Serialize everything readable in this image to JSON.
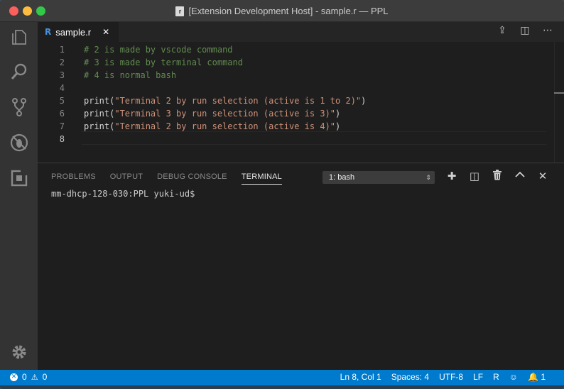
{
  "window": {
    "title": "[Extension Development Host] - sample.r — PPL",
    "title_icon": "r-file-icon"
  },
  "activity_bar": {
    "items": [
      {
        "name": "explorer-icon"
      },
      {
        "name": "search-icon"
      },
      {
        "name": "source-control-icon"
      },
      {
        "name": "debug-icon"
      },
      {
        "name": "extensions-icon"
      }
    ],
    "bottom": {
      "name": "settings-gear-icon"
    }
  },
  "tabs": [
    {
      "label": "sample.r",
      "icon": "R",
      "close": "✕"
    }
  ],
  "editor_actions": [
    "⇪",
    "◫",
    "⋯"
  ],
  "editor": {
    "lines": [
      {
        "num": "1",
        "parts": [
          {
            "t": "comment",
            "s": "# 2 is made by vscode command"
          }
        ]
      },
      {
        "num": "2",
        "parts": [
          {
            "t": "comment",
            "s": "# 3 is made by terminal command"
          }
        ]
      },
      {
        "num": "3",
        "parts": [
          {
            "t": "comment",
            "s": "# 4 is normal bash"
          }
        ]
      },
      {
        "num": "4",
        "parts": []
      },
      {
        "num": "5",
        "parts": [
          {
            "t": "func",
            "s": "print("
          },
          {
            "t": "str",
            "s": "\"Terminal 2 by run selection (active is 1 to 2)\""
          },
          {
            "t": "func",
            "s": ")"
          }
        ]
      },
      {
        "num": "6",
        "parts": [
          {
            "t": "func",
            "s": "print("
          },
          {
            "t": "str",
            "s": "\"Terminal 3 by run selection (active is 3)\""
          },
          {
            "t": "func",
            "s": ")"
          }
        ]
      },
      {
        "num": "7",
        "parts": [
          {
            "t": "func",
            "s": "print("
          },
          {
            "t": "str",
            "s": "\"Terminal 2 by run selection (active is 4)\""
          },
          {
            "t": "func",
            "s": ")"
          }
        ]
      },
      {
        "num": "8",
        "parts": [],
        "active": true
      }
    ]
  },
  "panel": {
    "tabs": [
      {
        "label": "PROBLEMS",
        "active": false
      },
      {
        "label": "OUTPUT",
        "active": false
      },
      {
        "label": "DEBUG CONSOLE",
        "active": false
      },
      {
        "label": "TERMINAL",
        "active": true
      }
    ],
    "terminal_select": "1: bash",
    "actions": [
      {
        "name": "new-terminal-icon",
        "glyph": "✚"
      },
      {
        "name": "split-terminal-icon",
        "glyph": "◫"
      },
      {
        "name": "kill-terminal-icon",
        "glyph": "🗑"
      },
      {
        "name": "maximize-panel-icon",
        "glyph": "⌃"
      },
      {
        "name": "close-panel-icon",
        "glyph": "✕"
      }
    ],
    "terminal_output": "mm-dhcp-128-030:PPL yuki-ud$"
  },
  "status_bar": {
    "errors": "0",
    "warnings": "0",
    "position": "Ln 8, Col 1",
    "spaces": "Spaces: 4",
    "encoding": "UTF-8",
    "eol": "LF",
    "language": "R",
    "notifications": "1"
  },
  "colors": {
    "accent": "#007acc",
    "comment": "#608b4e",
    "string": "#ce9178"
  }
}
